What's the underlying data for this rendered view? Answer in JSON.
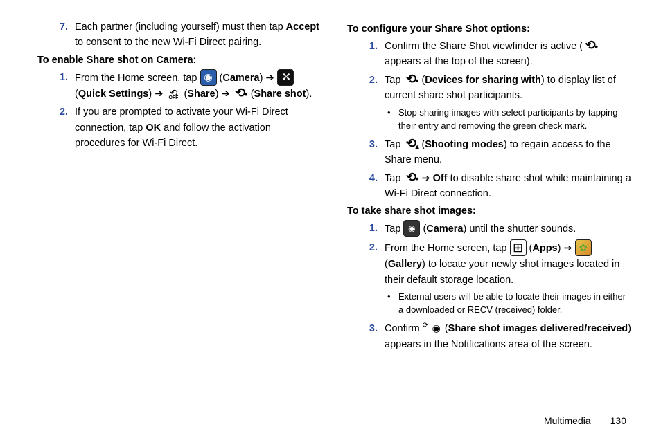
{
  "left": {
    "step7": {
      "num": "7.",
      "text_a": "Each partner (including yourself) must then tap ",
      "accept": "Accept",
      "text_b": " to consent to the new Wi-Fi Direct pairing."
    },
    "heading1": "To enable Share shot on Camera:",
    "s1": {
      "num": "1.",
      "a": "From the Home screen, tap ",
      "camera": "Camera",
      "arrow1": " ➔ ",
      "qset": "Quick Settings",
      "arrow2": " ➔ ",
      "share": "Share",
      "arrow3": " ➔ ",
      "sshot": "Share shot",
      "end": "."
    },
    "s2": {
      "num": "2.",
      "a": "If you are prompted to activate your Wi-Fi Direct connection, tap ",
      "ok": "OK",
      "b": " and follow the activation procedures for Wi-Fi Direct."
    }
  },
  "right": {
    "heading1": "To configure your Share Shot options:",
    "c1": {
      "num": "1.",
      "a": "Confirm the Share Shot viewfinder is active (",
      "b": " appears at the top of the screen)."
    },
    "c2": {
      "num": "2.",
      "a": "Tap ",
      "dev": "Devices for sharing with",
      "b": " to display list of current share shot participants."
    },
    "c2b": "Stop sharing images with select participants by tapping their entry and removing the green check mark.",
    "c3": {
      "num": "3.",
      "a": "Tap ",
      "sm": "Shooting modes",
      "b": " to regain access to the Share menu."
    },
    "c4": {
      "num": "4.",
      "a": "Tap ",
      "arrow": " ➔ ",
      "off": "Off",
      "b": " to disable share shot while maintaining a Wi-Fi Direct connection."
    },
    "heading2": "To take share shot images:",
    "t1": {
      "num": "1.",
      "a": "Tap ",
      "cam": "Camera",
      "b": " until the shutter sounds."
    },
    "t2": {
      "num": "2.",
      "a": "From the Home screen, tap ",
      "apps": "Apps",
      "arrow": " ➔ ",
      "gal": "Gallery",
      "b": " to locate your newly shot images located in their default storage location."
    },
    "t2b_a": "External users will be able to locate their images in either a downloaded or ",
    "t2b_recv": "RECV",
    "t2b_b": " (received) folder.",
    "t3": {
      "num": "3.",
      "a": "Confirm ",
      "deliv": "Share shot images delivered/received",
      "b": " appears in the Notifications area of the screen."
    }
  },
  "footer": {
    "section": "Multimedia",
    "page": "130"
  }
}
